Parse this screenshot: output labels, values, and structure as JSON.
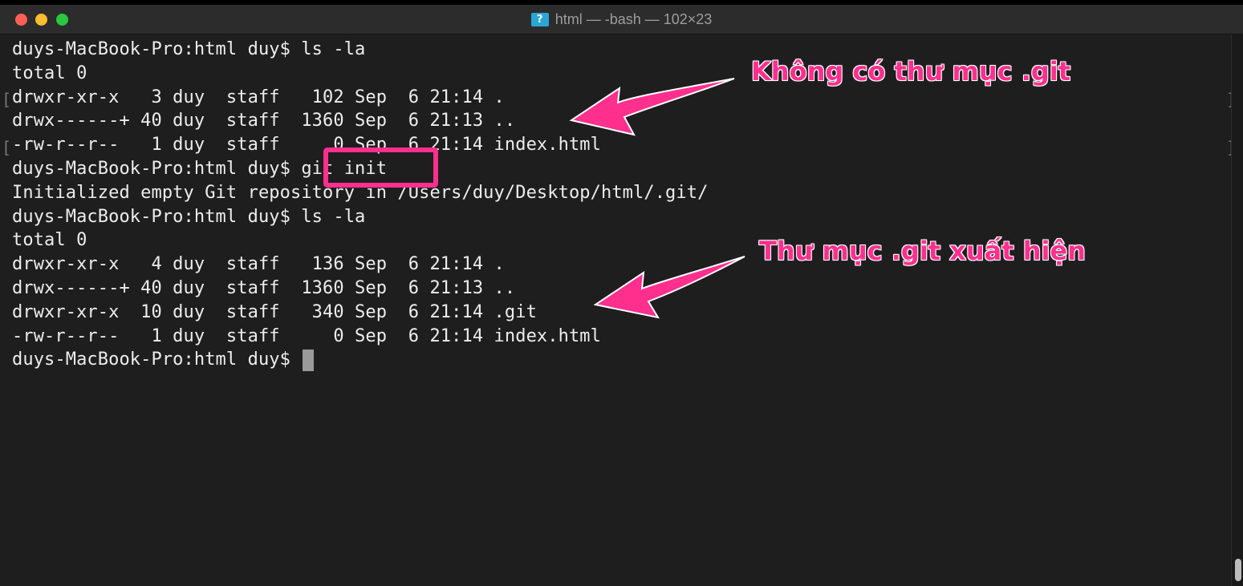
{
  "window": {
    "title": "html — -bash — 102×23",
    "title_icon": "folder-question-icon",
    "title_icon_glyph": "?"
  },
  "terminal": {
    "lines": [
      "duys-MacBook-Pro:html duy$ ls -la",
      "total 0",
      "drwxr-xr-x   3 duy  staff   102 Sep  6 21:14 .",
      "drwx------+ 40 duy  staff  1360 Sep  6 21:13 ..",
      "-rw-r--r--   1 duy  staff     0 Sep  6 21:14 index.html",
      "duys-MacBook-Pro:html duy$ git init",
      "Initialized empty Git repository in /Users/duy/Desktop/html/.git/",
      "duys-MacBook-Pro:html duy$ ls -la",
      "total 0",
      "drwxr-xr-x   4 duy  staff   136 Sep  6 21:14 .",
      "drwx------+ 40 duy  staff  1360 Sep  6 21:13 ..",
      "drwxr-xr-x  10 duy  staff   340 Sep  6 21:14 .git",
      "-rw-r--r--   1 duy  staff     0 Sep  6 21:14 index.html",
      "duys-MacBook-Pro:html duy$ "
    ]
  },
  "annotations": {
    "no_git_label": "Không có thư mục .git",
    "git_appears_label": "Thư mục .git xuất hiện"
  },
  "colors": {
    "annotation": "#ff2f8e",
    "terminal_bg": "#1e1e1e",
    "terminal_text": "#ededed"
  }
}
